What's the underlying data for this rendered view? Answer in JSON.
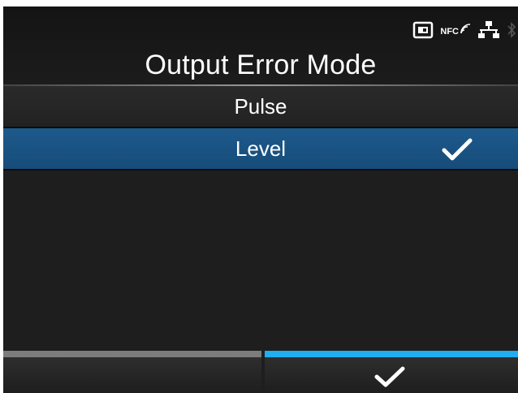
{
  "screen": {
    "title": "Output Error Mode"
  },
  "status_bar": {
    "icons": [
      "sd-card-icon",
      "nfc-icon",
      "lan-icon",
      "bluetooth-icon"
    ],
    "nfc_label": "NFC"
  },
  "options": [
    {
      "label": "Pulse",
      "selected": false
    },
    {
      "label": "Level",
      "selected": true
    }
  ],
  "softkeys": {
    "left": {
      "label": ""
    },
    "right": {
      "icon": "checkmark-icon",
      "action": "confirm"
    }
  },
  "colors": {
    "background": "#1e1e1e",
    "selected_row": "#1d5a8c",
    "accent": "#1faef0",
    "left_key_bar": "#7c7c7c"
  }
}
